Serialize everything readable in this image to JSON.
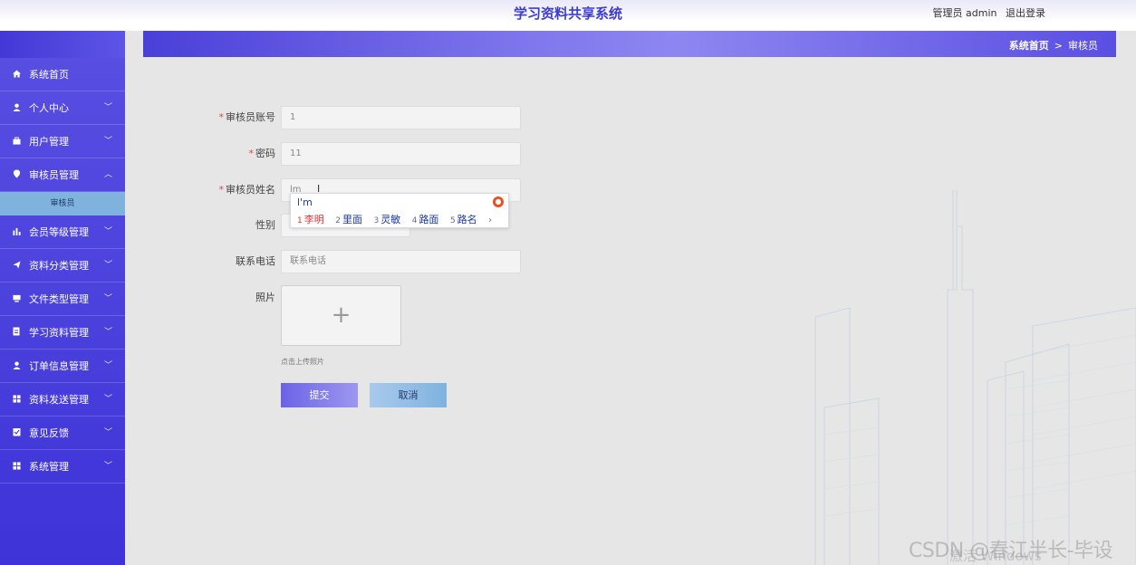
{
  "header": {
    "title": "学习资料共享系统",
    "user_label": "管理员 admin",
    "logout_label": "退出登录"
  },
  "sidebar": {
    "items": [
      {
        "label": "系统首页",
        "icon": "home-icon"
      },
      {
        "label": "个人中心",
        "icon": "user-icon"
      },
      {
        "label": "用户管理",
        "icon": "briefcase-icon"
      },
      {
        "label": "审核员管理",
        "icon": "map-pin-icon"
      },
      {
        "label": "会员等级管理",
        "icon": "bar-chart-icon"
      },
      {
        "label": "资料分类管理",
        "icon": "send-icon"
      },
      {
        "label": "文件类型管理",
        "icon": "monitor-icon"
      },
      {
        "label": "学习资料管理",
        "icon": "document-icon"
      },
      {
        "label": "订单信息管理",
        "icon": "user-icon"
      },
      {
        "label": "资料发送管理",
        "icon": "grid-icon"
      },
      {
        "label": "意见反馈",
        "icon": "clipboard-check-icon"
      },
      {
        "label": "系统管理",
        "icon": "grid-icon"
      }
    ],
    "submenu_label": "审核员"
  },
  "breadcrumb": {
    "home": "系统首页",
    "separator": ">",
    "current": "审核员"
  },
  "form": {
    "account": {
      "label": "审核员账号",
      "value": "1"
    },
    "password": {
      "label": "密码",
      "value": "11"
    },
    "name": {
      "label": "审核员姓名",
      "value": "lm"
    },
    "gender": {
      "label": "性别",
      "value": ""
    },
    "phone": {
      "label": "联系电话",
      "placeholder": "联系电话"
    },
    "photo": {
      "label": "照片",
      "hint": "点击上传照片"
    },
    "submit_label": "提交",
    "cancel_label": "取消"
  },
  "ime": {
    "composition": "l'm",
    "candidates": [
      {
        "num": "1",
        "text": "李明"
      },
      {
        "num": "2",
        "text": "里面"
      },
      {
        "num": "3",
        "text": "灵敏"
      },
      {
        "num": "4",
        "text": "路面"
      },
      {
        "num": "5",
        "text": "路名"
      }
    ],
    "next": "›"
  },
  "watermark": {
    "text": "CSDN @春江半长-毕设",
    "activate": "激活 Windows"
  },
  "colors": {
    "accent": "#4a40dc",
    "submenu": "#7fb3dd",
    "title": "#3b3bd6",
    "required": "#e04545"
  }
}
